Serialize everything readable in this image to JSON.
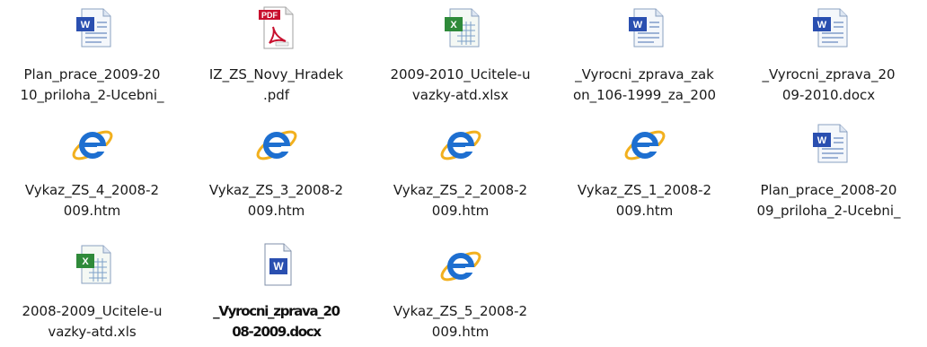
{
  "desktop": {
    "items": [
      {
        "line1": "Plan_prace_2009-20",
        "line2": "10_priloha_2-Ucebni_",
        "icon": "word-document-icon"
      },
      {
        "line1": "IZ_ZS_Novy_Hradek",
        "line2": ".pdf",
        "icon": "pdf-document-icon"
      },
      {
        "line1": "2009-2010_Ucitele-u",
        "line2": "vazky-atd.xlsx",
        "icon": "excel-spreadsheet-icon"
      },
      {
        "line1": "_Vyrocni_zprava_zak",
        "line2": "on_106-1999_za_200",
        "icon": "word-document-icon"
      },
      {
        "line1": "_Vyrocni_zprava_20",
        "line2": "09-2010.docx",
        "icon": "word-document-icon"
      },
      {
        "line1": "Vykaz_ZS_4_2008-2",
        "line2": "009.htm",
        "icon": "internet-explorer-icon"
      },
      {
        "line1": "Vykaz_ZS_3_2008-2",
        "line2": "009.htm",
        "icon": "internet-explorer-icon"
      },
      {
        "line1": "Vykaz_ZS_2_2008-2",
        "line2": "009.htm",
        "icon": "internet-explorer-icon"
      },
      {
        "line1": "Vykaz_ZS_1_2008-2",
        "line2": "009.htm",
        "icon": "internet-explorer-icon"
      },
      {
        "line1": "Plan_prace_2008-20",
        "line2": "09_priloha_2-Ucebni_",
        "icon": "word-document-icon"
      },
      {
        "line1": "2008-2009_Ucitele-u",
        "line2": "vazky-atd.xls",
        "icon": "excel-spreadsheet-icon"
      },
      {
        "line1": "_Vyrocni_zprava_20",
        "line2": "08-2009.docx",
        "icon": "word-document-icon"
      },
      {
        "line1": "Vykaz_ZS_5_2008-2",
        "line2": "009.htm",
        "icon": "internet-explorer-icon"
      }
    ],
    "colors": {
      "word_blue": "#2a4fb0",
      "excel_green": "#2f8a3a",
      "pdf_red": "#c8102e",
      "ie_blue": "#1e6fd0",
      "ie_ring": "#f2b01e"
    }
  }
}
